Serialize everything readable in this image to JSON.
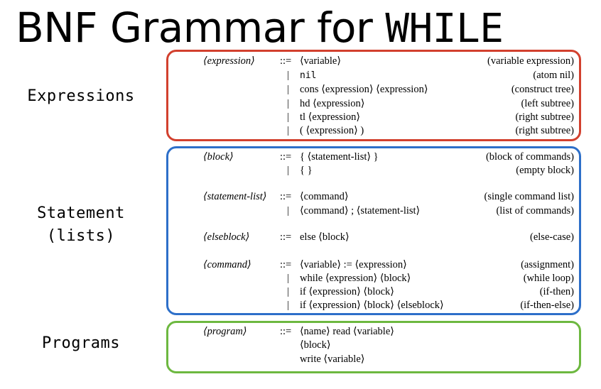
{
  "title": {
    "text": "BNF Grammar for ",
    "keyword": "WHILE"
  },
  "sections": {
    "expressions": "Expressions",
    "statements_line1": "Statement",
    "statements_line2": "(lists)",
    "programs": "Programs"
  },
  "rules": {
    "expression": {
      "nt": "⟨expression⟩",
      "def": "::=",
      "alts": [
        {
          "bar": "",
          "rhs": "⟨variable⟩",
          "comment": "(variable expression)"
        },
        {
          "bar": "|",
          "rhs": "nil",
          "comment": "(atom nil)"
        },
        {
          "bar": "|",
          "rhs": "cons ⟨expression⟩ ⟨expression⟩",
          "comment": "(construct tree)"
        },
        {
          "bar": "|",
          "rhs": "hd ⟨expression⟩",
          "comment": "(left subtree)"
        },
        {
          "bar": "|",
          "rhs": "tl ⟨expression⟩",
          "comment": "(right subtree)"
        },
        {
          "bar": "|",
          "rhs": "( ⟨expression⟩ )",
          "comment": "(right subtree)"
        }
      ]
    },
    "block": {
      "nt": "⟨block⟩",
      "def": "::=",
      "alts": [
        {
          "bar": "",
          "rhs": "{ ⟨statement-list⟩ }",
          "comment": "(block of commands)"
        },
        {
          "bar": "|",
          "rhs": "{ }",
          "comment": "(empty block)"
        }
      ]
    },
    "statement_list": {
      "nt": "⟨statement-list⟩",
      "def": "::=",
      "alts": [
        {
          "bar": "",
          "rhs": "⟨command⟩",
          "comment": "(single command list)"
        },
        {
          "bar": "|",
          "rhs": "⟨command⟩ ; ⟨statement-list⟩",
          "comment": "(list of commands)"
        }
      ]
    },
    "elseblock": {
      "nt": "⟨elseblock⟩",
      "def": "::=",
      "alts": [
        {
          "bar": "",
          "rhs": "else ⟨block⟩",
          "comment": "(else-case)"
        }
      ]
    },
    "command": {
      "nt": "⟨command⟩",
      "def": "::=",
      "alts": [
        {
          "bar": "",
          "rhs": "⟨variable⟩ := ⟨expression⟩",
          "comment": "(assignment)"
        },
        {
          "bar": "|",
          "rhs": "while ⟨expression⟩ ⟨block⟩",
          "comment": "(while loop)"
        },
        {
          "bar": "|",
          "rhs": "if ⟨expression⟩ ⟨block⟩",
          "comment": "(if-then)"
        },
        {
          "bar": "|",
          "rhs": "if ⟨expression⟩ ⟨block⟩ ⟨elseblock⟩",
          "comment": "(if-then-else)"
        }
      ]
    },
    "program": {
      "nt": "⟨program⟩",
      "def": "::=",
      "lines": [
        "⟨name⟩ read ⟨variable⟩",
        "⟨block⟩",
        "write ⟨variable⟩"
      ]
    }
  },
  "colors": {
    "expressions_box": "#d2402e",
    "statements_box": "#2d6fc9",
    "programs_box": "#6db840"
  }
}
